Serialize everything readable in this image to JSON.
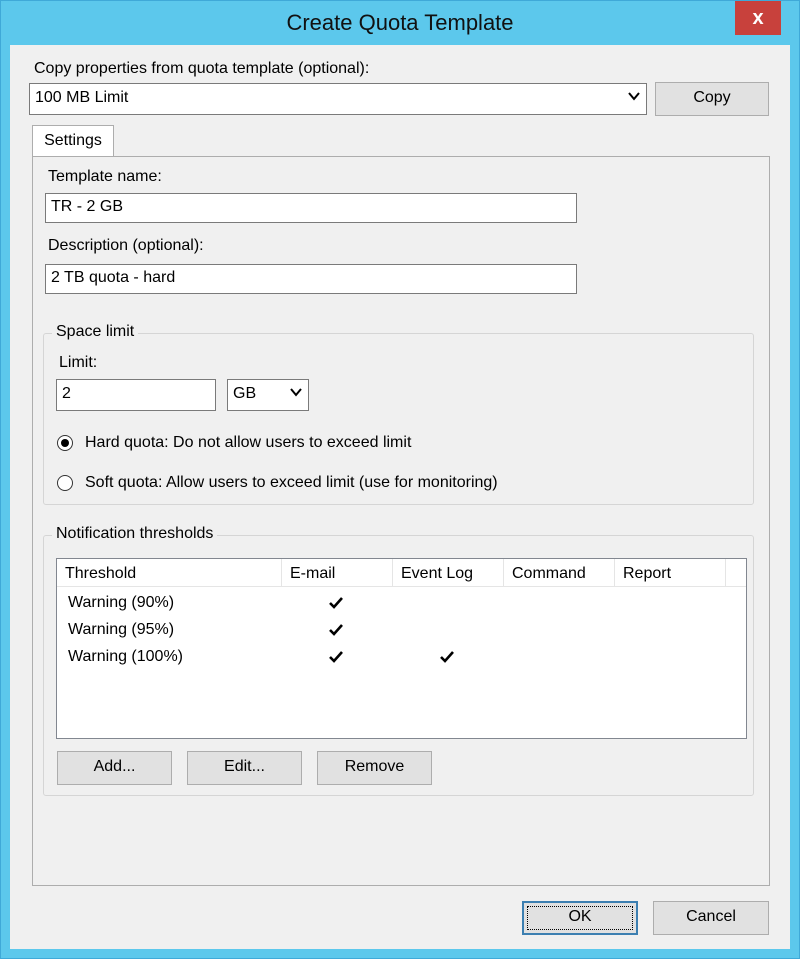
{
  "window": {
    "title": "Create Quota Template",
    "close_glyph": "x"
  },
  "copy_section": {
    "label": "Copy properties from quota template (optional):",
    "selected": "100 MB Limit",
    "copy_button": "Copy"
  },
  "tabs": [
    {
      "label": "Settings",
      "selected": true
    }
  ],
  "settings": {
    "template_name_label": "Template name:",
    "template_name_value": "TR - 2 GB",
    "description_label": "Description (optional):",
    "description_value": "2 TB quota - hard"
  },
  "space_limit": {
    "legend": "Space limit",
    "limit_label": "Limit:",
    "limit_value": "2",
    "unit": "GB",
    "hard_quota_label": "Hard quota: Do not allow users to exceed limit",
    "soft_quota_label": "Soft quota: Allow users to exceed limit (use for monitoring)",
    "selected_quota": "hard"
  },
  "notifications": {
    "legend": "Notification thresholds",
    "columns": [
      "Threshold",
      "E-mail",
      "Event Log",
      "Command",
      "Report"
    ],
    "rows": [
      {
        "threshold": "Warning (90%)",
        "email": true,
        "event_log": false,
        "command": false,
        "report": false
      },
      {
        "threshold": "Warning (95%)",
        "email": true,
        "event_log": false,
        "command": false,
        "report": false
      },
      {
        "threshold": "Warning (100%)",
        "email": true,
        "event_log": true,
        "command": false,
        "report": false
      }
    ],
    "add_button": "Add...",
    "edit_button": "Edit...",
    "remove_button": "Remove"
  },
  "footer": {
    "ok_button": "OK",
    "cancel_button": "Cancel"
  },
  "colors": {
    "titlebar": "#5cc8ec",
    "close_button": "#c8413c",
    "dialog_bg": "#f0f0f0",
    "default_button_border": "#3c7fb1"
  }
}
